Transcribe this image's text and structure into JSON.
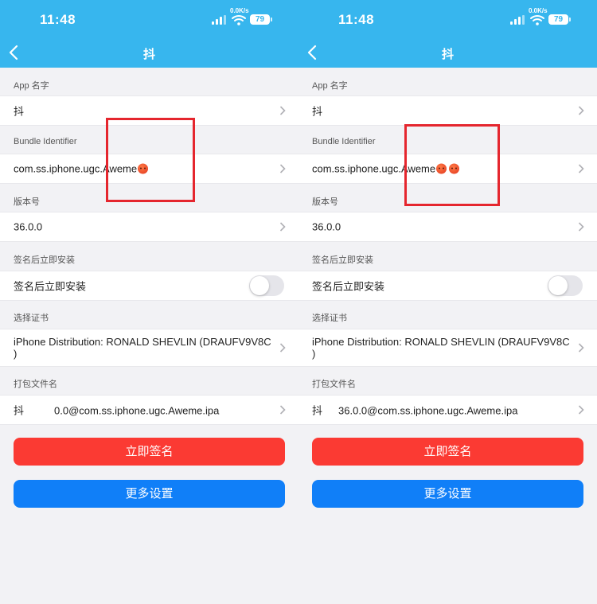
{
  "status_bar": {
    "time": "11:48",
    "netspeed": "0.0K/s",
    "battery": "79"
  },
  "left": {
    "title": "抖",
    "app_name_label": "App 名字",
    "app_name": "抖",
    "bundle_label": "Bundle Identifier",
    "bundle_id": "com.ss.iphone.ugc.Aweme",
    "version_label": "版本号",
    "version": "36.0.0",
    "install_label": "签名后立即安装",
    "install_row": "签名后立即安装",
    "cert_label": "选择证书",
    "cert_value": "iPhone Distribution: RONALD SHEVLIN (DRAUFV9V8C )",
    "package_label": "打包文件名",
    "package_prefix": "抖",
    "package_name": "0.0@com.ss.iphone.ugc.Aweme.ipa",
    "sign_button": "立即签名",
    "more_button": "更多设置"
  },
  "right": {
    "title": "抖",
    "app_name_label": "App 名字",
    "app_name": "抖",
    "bundle_label": "Bundle Identifier",
    "bundle_id": "com.ss.iphone.ugc.Aweme",
    "version_label": "版本号",
    "version": "36.0.0",
    "install_label": "签名后立即安装",
    "install_row": "签名后立即安装",
    "cert_label": "选择证书",
    "cert_value": "iPhone Distribution: RONALD SHEVLIN (DRAUFV9V8C )",
    "package_label": "打包文件名",
    "package_prefix": "抖",
    "package_name": "36.0.0@com.ss.iphone.ugc.Aweme.ipa",
    "sign_button": "立即签名",
    "more_button": "更多设置"
  },
  "icons": {
    "back": "chevron-left-icon",
    "row_arrow": "chevron-right-icon",
    "bundle_emoji": "angry-face-icon"
  },
  "colors": {
    "header": "#37b6ee",
    "sign_button": "#fb3a33",
    "more_button": "#107ff8",
    "highlight": "#e5262e"
  }
}
